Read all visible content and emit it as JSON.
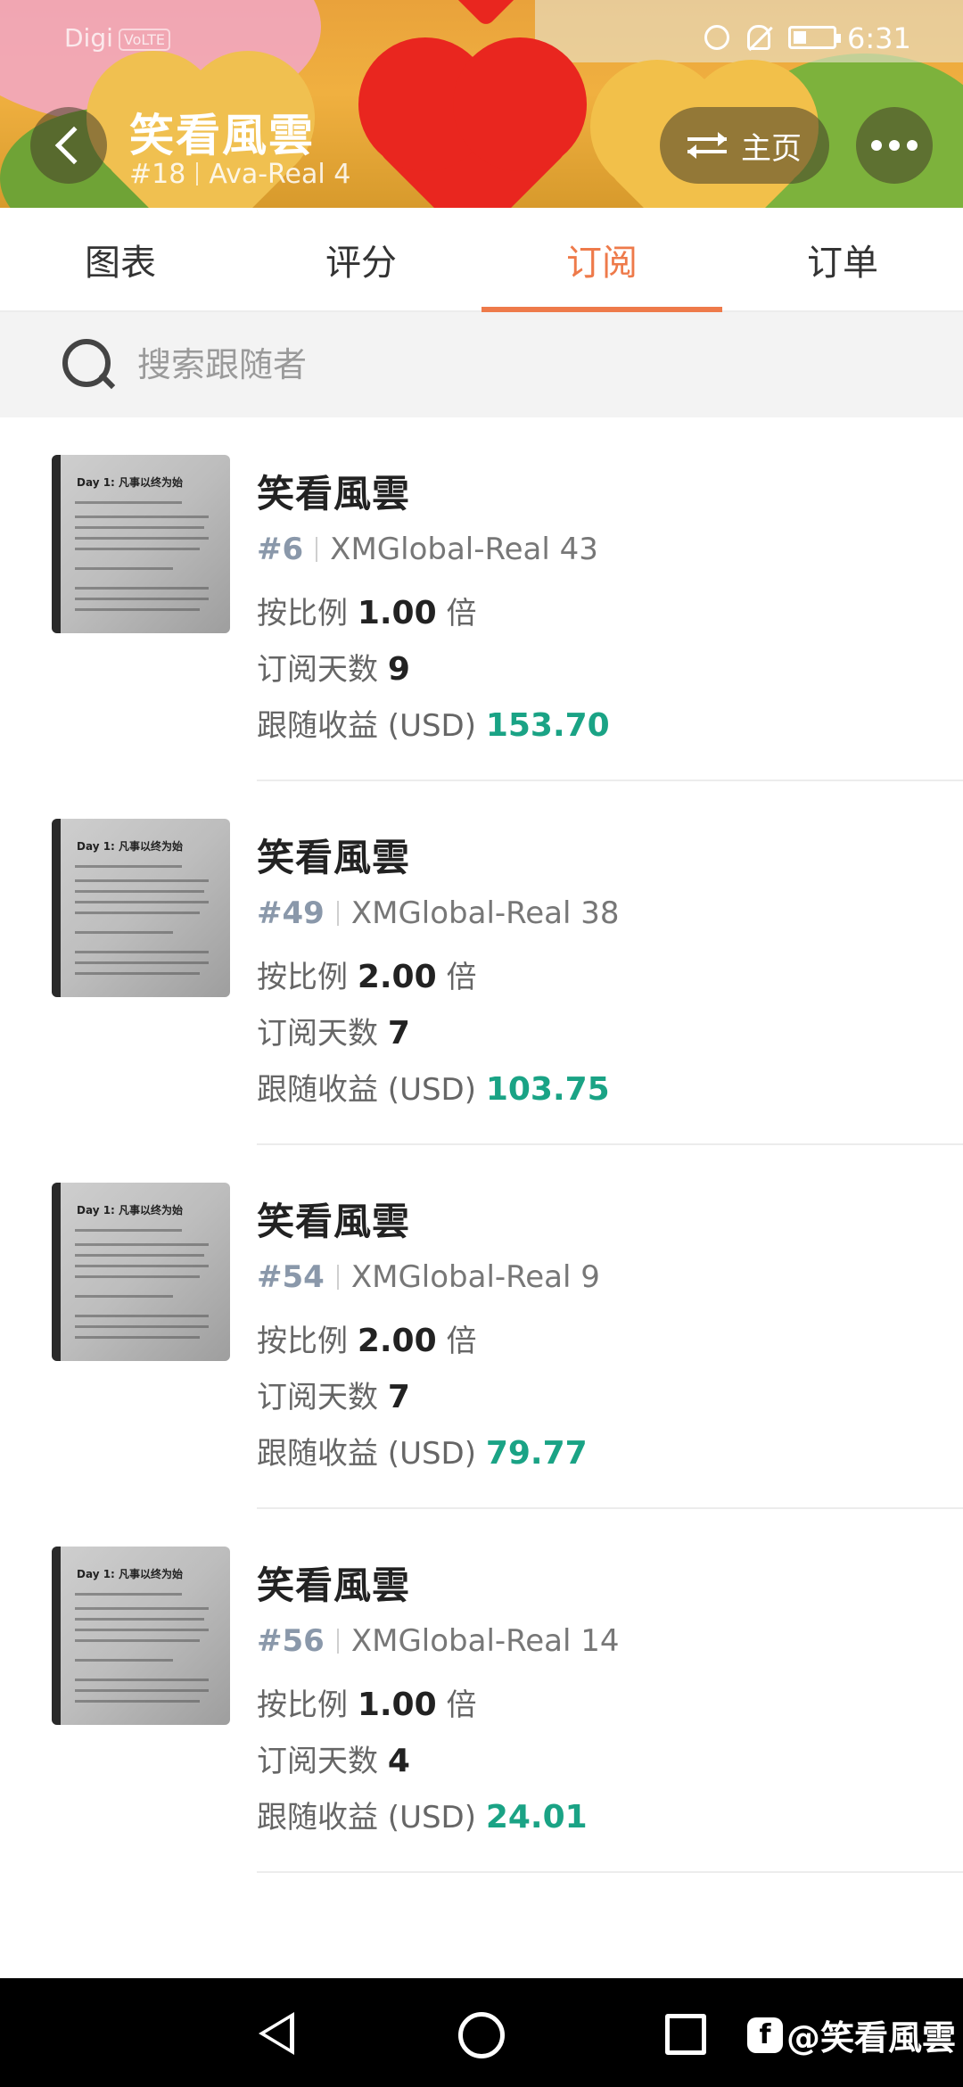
{
  "status_bar": {
    "carrier": "Digi",
    "network_badge": "VoLTE",
    "time": "6:31"
  },
  "header": {
    "title": "笑看風雲",
    "rank": "#18",
    "account": "Ava-Real 4",
    "home_label": "主页"
  },
  "tabs": [
    {
      "label": "图表",
      "active": false
    },
    {
      "label": "评分",
      "active": false
    },
    {
      "label": "订阅",
      "active": true
    },
    {
      "label": "订单",
      "active": false
    }
  ],
  "search": {
    "placeholder": "搜索跟随者"
  },
  "labels": {
    "ratio_prefix": "按比例",
    "ratio_suffix": "倍",
    "days_label": "订阅天数",
    "profit_label": "跟随收益 (USD)"
  },
  "thumbnail_text": "Day 1: 凡事以终为始",
  "followers": [
    {
      "name": "笑看風雲",
      "rank": "#6",
      "account": "XMGlobal-Real 43",
      "ratio": "1.00",
      "days": "9",
      "profit": "153.70"
    },
    {
      "name": "笑看風雲",
      "rank": "#49",
      "account": "XMGlobal-Real 38",
      "ratio": "2.00",
      "days": "7",
      "profit": "103.75"
    },
    {
      "name": "笑看風雲",
      "rank": "#54",
      "account": "XMGlobal-Real 9",
      "ratio": "2.00",
      "days": "7",
      "profit": "79.77"
    },
    {
      "name": "笑看風雲",
      "rank": "#56",
      "account": "XMGlobal-Real 14",
      "ratio": "1.00",
      "days": "4",
      "profit": "24.01"
    }
  ],
  "watermark": {
    "icon_glyph": "f",
    "text": "@笑看風雲"
  },
  "colors": {
    "accent": "#ee7a4a",
    "profit": "#1aa385",
    "rank": "#8a98aa"
  },
  "icons": [
    "back-icon",
    "swap-icon",
    "more-icon",
    "search-icon",
    "alarm-icon",
    "mute-icon",
    "battery-icon",
    "nav-back-icon",
    "nav-home-icon",
    "nav-recents-icon",
    "facebook-icon"
  ]
}
